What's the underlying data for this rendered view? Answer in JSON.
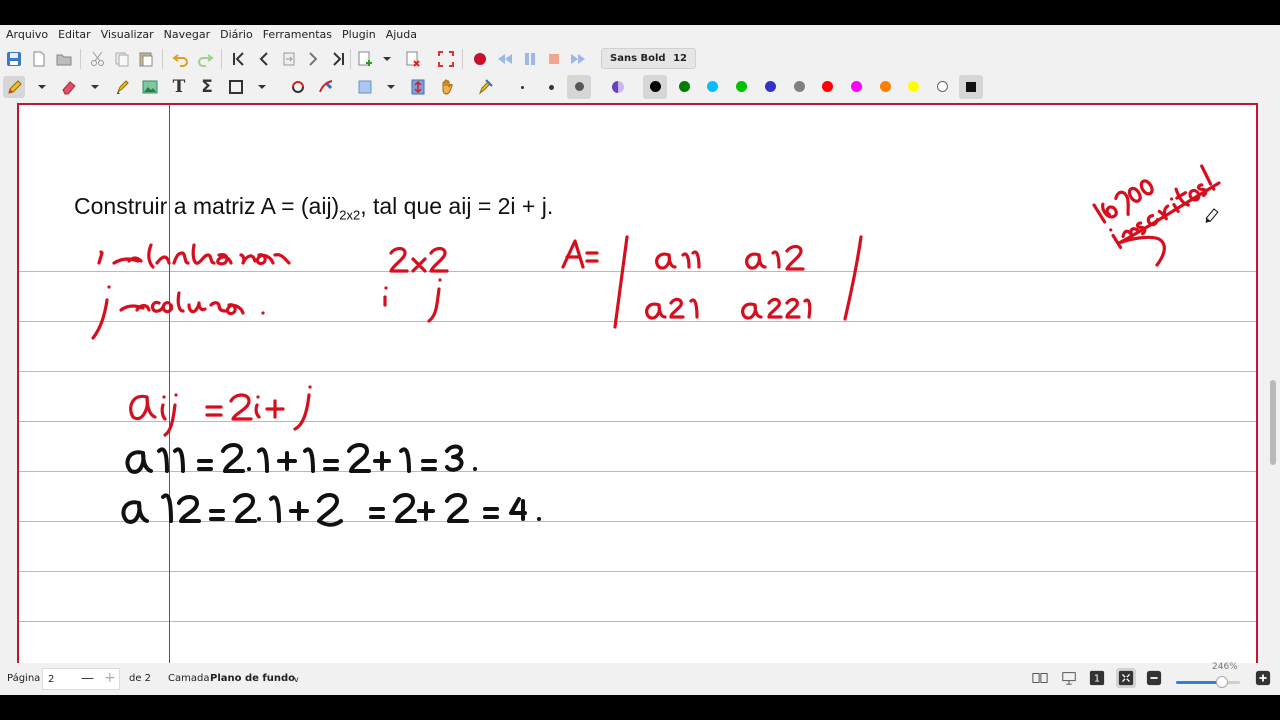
{
  "menu": [
    "Arquivo",
    "Editar",
    "Visualizar",
    "Navegar",
    "Diário",
    "Ferramentas",
    "Plugin",
    "Ajuda"
  ],
  "font": {
    "name": "Sans Bold",
    "size": "12"
  },
  "toolbar_icons": {
    "row1": [
      "save-icon",
      "new-icon",
      "open-icon",
      "cut-icon",
      "copy-icon",
      "paste-icon",
      "undo-icon",
      "redo-icon",
      "first-page-icon",
      "prev-page-icon",
      "goto-page-icon",
      "next-page-icon",
      "last-page-icon",
      "new-page-icon",
      "new-page-dropdown-icon",
      "delete-page-icon",
      "fullscreen-icon",
      "record-icon",
      "rewind-icon",
      "pause-icon",
      "stop-icon",
      "fast-forward-icon"
    ],
    "row2": [
      "pen-icon",
      "eraser-icon",
      "highlighter-icon",
      "image-icon",
      "text-icon",
      "sigma-icon",
      "rectangle-icon",
      "shape-recognizer-icon",
      "hand-eraser-icon",
      "select-rect-icon",
      "vertical-space-icon",
      "hand-icon",
      "default-tool-icon"
    ]
  },
  "colors": {
    "palette": [
      "#000000",
      "#008000",
      "#00c0ff",
      "#00c000",
      "#3333cc",
      "#808080",
      "#ff0000",
      "#ff00ff",
      "#ff8000",
      "#ffff00",
      "#ffffff"
    ],
    "selected": "#000000",
    "page_border": "#c11630",
    "rule_lines": "#8ec8e8",
    "margin_line": "#c0179f",
    "ink_red": "#d60f1f",
    "ink_black": "#111111"
  },
  "document": {
    "typed_text_before": "Construir a matriz A = (aij)",
    "typed_text_sub": "2x2",
    "typed_text_after": ", tal que aij = 2i + j."
  },
  "status": {
    "page_label": "Página",
    "page_number": "2",
    "page_total": "de 2",
    "layer_label": "Camada",
    "layer_value": "Plano de fundo",
    "zoom": "246%",
    "zoom_level": 0.72
  }
}
